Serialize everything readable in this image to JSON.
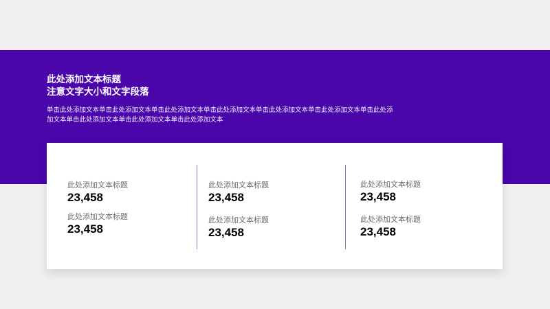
{
  "slide": {
    "title_line1": "此处添加文本标题",
    "title_line2": "注意文字大小和文字段落",
    "body_line1": "单击此处添加文本单击此处添加文本单击此处添加文本单击此处添加文本单击此处添加文本单击此处添加文本单击此处添",
    "body_line2": "加文本单击此处添加文本单击此处添加文本单击此处添加文本",
    "colors": {
      "band": "#4a05ab",
      "background": "#f0f0f0",
      "card": "#ffffff",
      "divider": "#6f86b5"
    }
  },
  "stats": [
    {
      "label": "此处添加文本标题",
      "value": "23,458"
    },
    {
      "label": "此处添加文本标题",
      "value": "23,458"
    },
    {
      "label": "此处添加文本标题",
      "value": "23,458"
    },
    {
      "label": "此处添加文本标题",
      "value": "23,458"
    },
    {
      "label": "此处添加文本标题",
      "value": "23,458"
    },
    {
      "label": "此处添加文本标题",
      "value": "23,458"
    }
  ]
}
